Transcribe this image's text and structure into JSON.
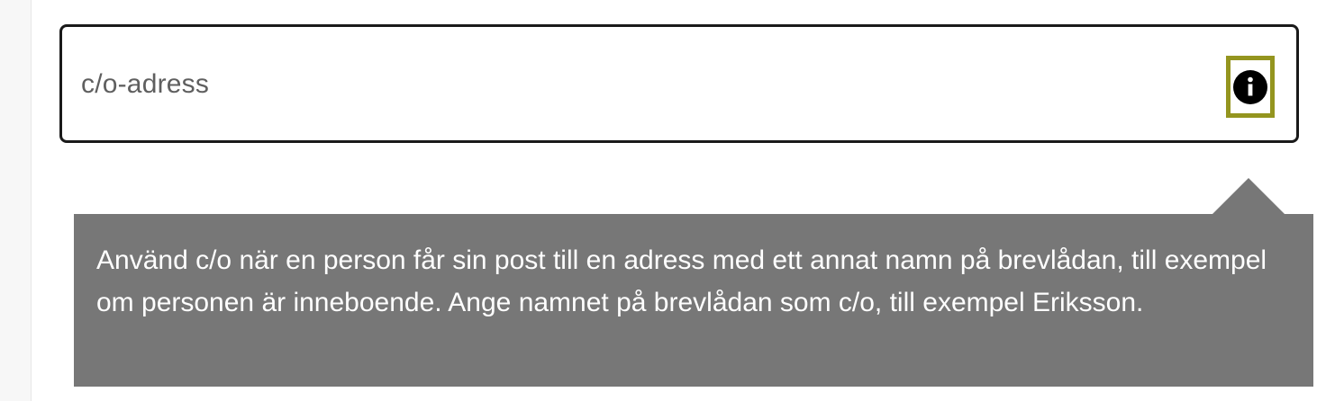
{
  "field": {
    "placeholder": "c/o-adress"
  },
  "info_button": {
    "icon": "info-icon",
    "accent_color": "#94951f"
  },
  "tooltip": {
    "text": "Använd c/o när en person får sin post till en adress med ett annat namn på brevlådan, till exempel om personen är inneboende. Ange namnet på brevlådan som c/o, till exempel Eriksson.",
    "background_color": "#777777"
  }
}
